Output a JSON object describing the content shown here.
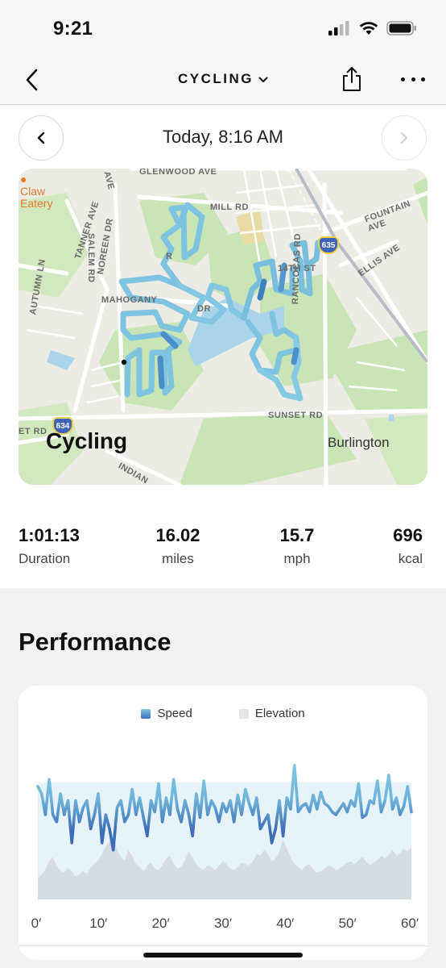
{
  "status_bar": {
    "time": "9:21"
  },
  "nav": {
    "title": "CYCLING"
  },
  "date": {
    "label": "Today, 8:16 AM"
  },
  "map": {
    "title": "Cycling",
    "town": "Burlington",
    "poi": "Claw\nEatery",
    "streets": {
      "glenwood": "GLENWOOD AVE",
      "mill": "MILL RD",
      "fountain": "FOUNTAIN AVE",
      "ellis": "ELLIS AVE",
      "rancocas": "RANCOCAS RD",
      "salem": "SALEM RD",
      "noreen": "NOREEN DR",
      "tanner": "TANNER AVE",
      "autumn": "AUTUMN LN",
      "mahogany": "MAHOGANY",
      "dr": "DR",
      "sunset": "SUNSET RD",
      "et_rd": "ET RD",
      "indian": "INDIAN",
      "fourteenth": "14TH ST",
      "ave": "AVE",
      "r": "R"
    },
    "badges": {
      "b635": "635",
      "b634": "634"
    }
  },
  "stats": [
    {
      "value": "1:01:13",
      "label": "Duration"
    },
    {
      "value": "16.02",
      "label": "miles"
    },
    {
      "value": "15.7",
      "label": "mph"
    },
    {
      "value": "696",
      "label": "kcal"
    }
  ],
  "performance": {
    "title": "Performance"
  },
  "colors": {
    "speed": "#5b9bd0",
    "elevation": "#e4e6ea",
    "route": "#7ec3e0"
  },
  "chart_data": {
    "type": "line",
    "series": [
      {
        "name": "Speed",
        "values": [
          17,
          16.5,
          15,
          17.5,
          15,
          14.5,
          16.5,
          15,
          16,
          13,
          16,
          14.5,
          15.5,
          16,
          14,
          15,
          16.5,
          13,
          15,
          14,
          12.5,
          15.5,
          16,
          14.5,
          15,
          16.8,
          15,
          16.2,
          14.8,
          13.5,
          16,
          15.2,
          17.2,
          14.5,
          16.2,
          15,
          17.5,
          15.4,
          14.5,
          16,
          15,
          13.5,
          16.5,
          14.8,
          17.4,
          15,
          16,
          15.5,
          14.5,
          15.8,
          15.2,
          16,
          14.5,
          16.4,
          15,
          16.8,
          15.8,
          15,
          16.2,
          14,
          14.5,
          15,
          13,
          14,
          16,
          13.5,
          16.2,
          15.4,
          18.5,
          15.2,
          15.6,
          15.8,
          15.2,
          16.4,
          15.4,
          16.6,
          15.8,
          15.6,
          15.2,
          15,
          15.4,
          15.8,
          15.2,
          16,
          15.6,
          17.2,
          14.8,
          15,
          16,
          15.8,
          17.4,
          15.2,
          16,
          17.8,
          15.4,
          16.2,
          15,
          15.6,
          17,
          15.2
        ]
      },
      {
        "name": "Elevation",
        "values": [
          3,
          3.5,
          4.2,
          5.5,
          6,
          4.8,
          4,
          3.8,
          4.5,
          4,
          3.2,
          3.5,
          4,
          3.6,
          4.5,
          5,
          5.5,
          6.5,
          7.5,
          8.2,
          9,
          7,
          6,
          5.5,
          7,
          6.2,
          5,
          4.6,
          4,
          4.8,
          5.2,
          4.4,
          4.2,
          4.8,
          5.8,
          6.2,
          5,
          4.4,
          4.6,
          5.6,
          6.8,
          6,
          5,
          4.5,
          4.2,
          4.8,
          4.6,
          4.2,
          4.8,
          5.4,
          5,
          4.4,
          4.2,
          4.6,
          5.2,
          5,
          4.8,
          5.4,
          6.4,
          6.2,
          7,
          6.4,
          5.4,
          5.8,
          6.8,
          8.4,
          7.2,
          6,
          5,
          4.6,
          4.2,
          4.8,
          5,
          4.2,
          3.8,
          4,
          4.4,
          4.8,
          4.6,
          4.2,
          4.4,
          4.8,
          5.2,
          5.4,
          5,
          5.6,
          6,
          5.4,
          4.8,
          5.2,
          5.6,
          6.2,
          5.8,
          6.4,
          7,
          6.2,
          6.6,
          7.2,
          6.8,
          7.4
        ]
      }
    ],
    "x_ticks": [
      "0′",
      "10′",
      "20′",
      "30′",
      "40′",
      "50′",
      "60′"
    ],
    "xlim": [
      0,
      60
    ],
    "speed_ylim": [
      9,
      19
    ],
    "elevation_ylim": [
      0,
      20
    ],
    "legend": "top-center",
    "grid": false
  }
}
